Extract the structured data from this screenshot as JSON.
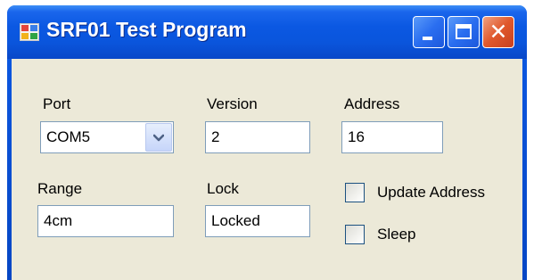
{
  "window": {
    "title": "SRF01 Test Program"
  },
  "form": {
    "port": {
      "label": "Port",
      "value": "COM5"
    },
    "version": {
      "label": "Version",
      "value": "2"
    },
    "address": {
      "label": "Address",
      "value": "16"
    },
    "range": {
      "label": "Range",
      "value": "4cm"
    },
    "lock": {
      "label": "Lock",
      "value": "Locked"
    },
    "update_address": {
      "label": "Update Address",
      "checked": false
    },
    "sleep": {
      "label": "Sleep",
      "checked": false
    }
  },
  "icons": {
    "app": "app-icon",
    "minimize": "minimize-icon",
    "maximize": "maximize-icon",
    "close": "close-icon",
    "dropdown": "chevron-down-icon"
  },
  "colors": {
    "titlebar": "#0a55dc",
    "client_background": "#ece9d8",
    "close_button": "#e0582c",
    "field_border": "#7f9db9"
  }
}
